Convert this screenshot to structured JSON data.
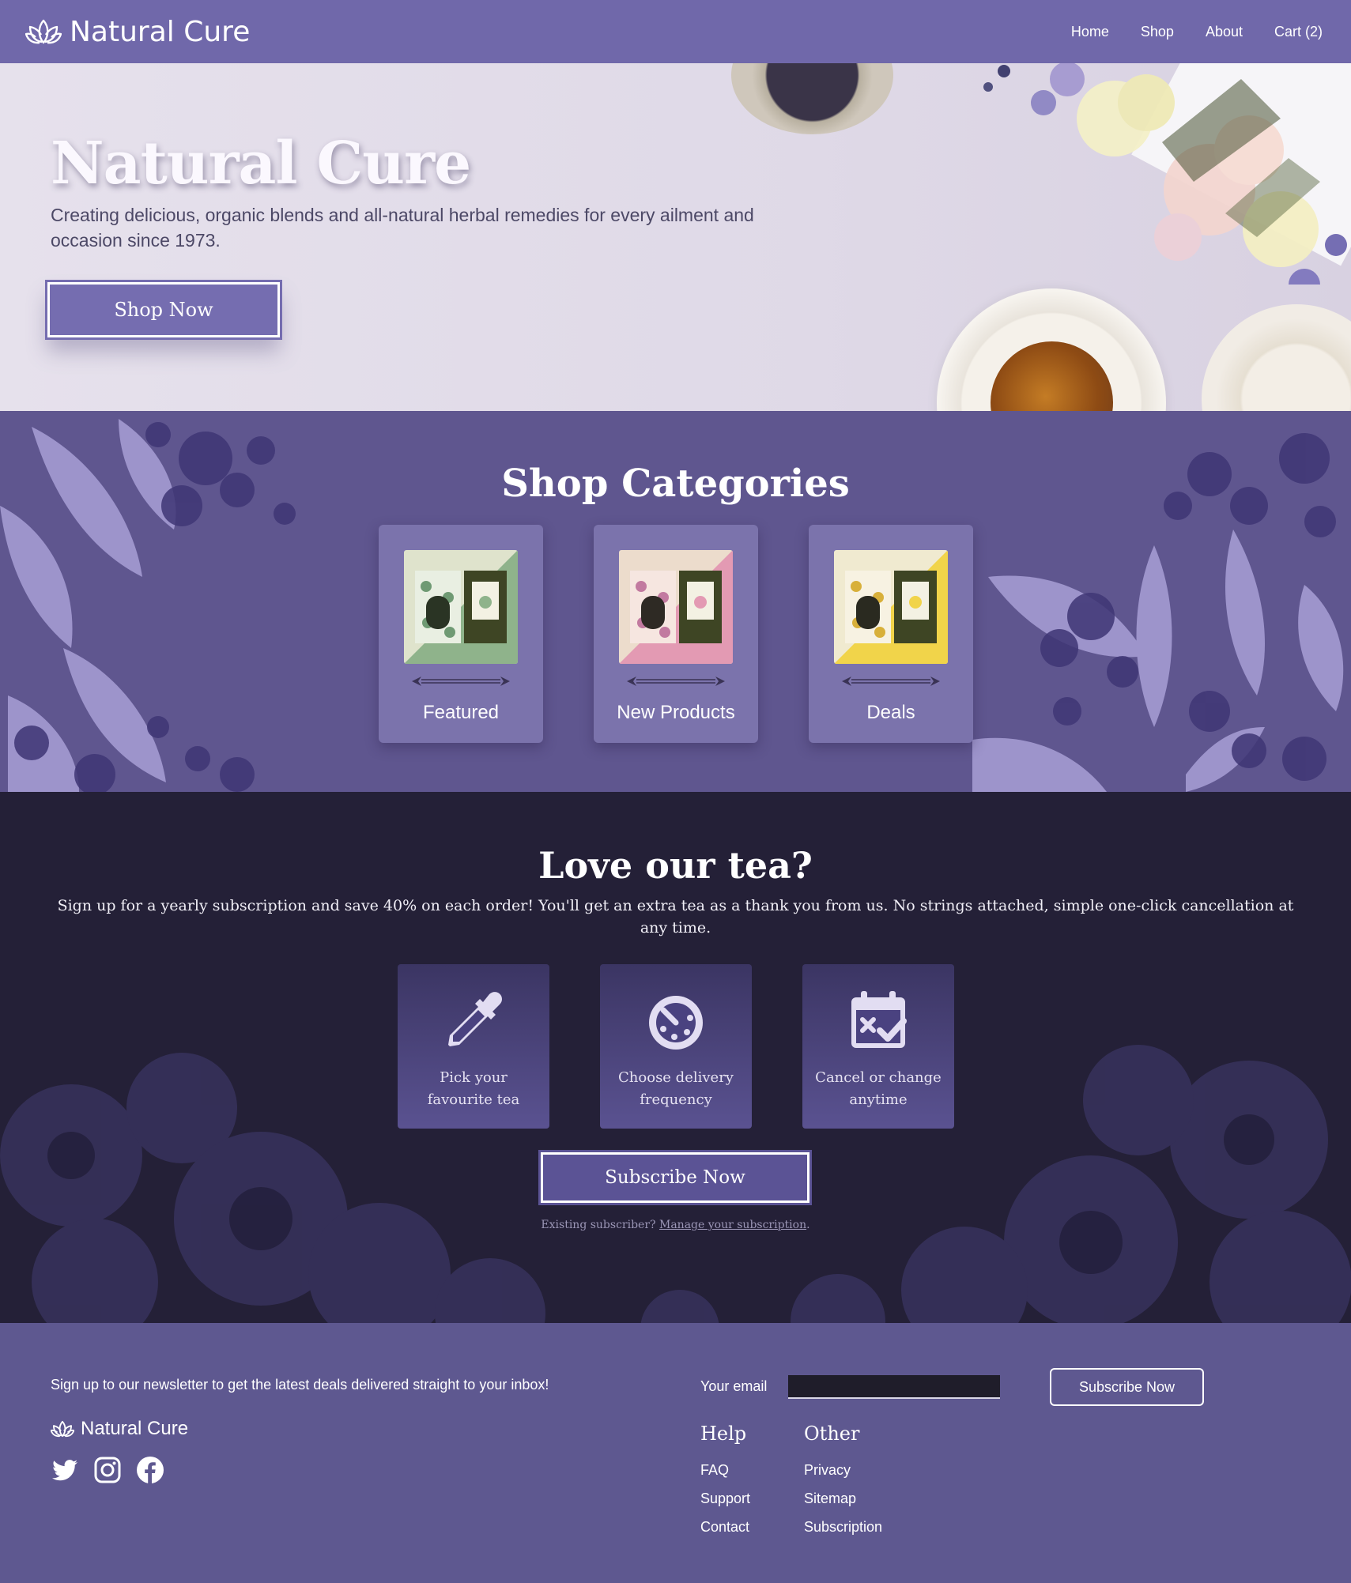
{
  "nav": {
    "brand": "Natural Cure",
    "links": [
      {
        "label": "Home"
      },
      {
        "label": "Shop"
      },
      {
        "label": "About"
      },
      {
        "label": "Cart (2)"
      }
    ]
  },
  "hero": {
    "title": "Natural Cure",
    "subtitle": "Creating delicious, organic blends and all-natural herbal remedies for every ailment and occasion since 1973.",
    "cta": "Shop Now"
  },
  "categories": {
    "title": "Shop Categories",
    "items": [
      {
        "label": "Featured",
        "accent": "#8fb38b"
      },
      {
        "label": "New Products",
        "accent": "#e39ab3"
      },
      {
        "label": "Deals",
        "accent": "#f1d44a"
      }
    ]
  },
  "subscription": {
    "title": "Love our tea?",
    "description": "Sign up for a yearly subscription and save 40% on each order! You'll get an extra tea as a thank you from us. No strings attached, simple one-click cancellation at any time.",
    "features": [
      {
        "label": "Pick your favourite tea",
        "icon": "eyedropper-icon"
      },
      {
        "label": "Choose delivery frequency",
        "icon": "stopwatch-icon"
      },
      {
        "label": "Cancel or change anytime",
        "icon": "calendar-check-icon"
      }
    ],
    "cta": "Subscribe Now",
    "existing_text": "Existing subscriber?",
    "existing_link": "Manage your subscription",
    "existing_end": "."
  },
  "footer": {
    "newsletter_text": "Sign up to our newsletter to get the latest deals delivered straight to your inbox!",
    "email_label": "Your email",
    "email_value": "",
    "subscribe_label": "Subscribe Now",
    "brand": "Natural Cure",
    "social": [
      "twitter-icon",
      "instagram-icon",
      "facebook-icon"
    ],
    "help": {
      "title": "Help",
      "links": [
        "FAQ",
        "Support",
        "Contact"
      ]
    },
    "other": {
      "title": "Other",
      "links": [
        "Privacy",
        "Sitemap",
        "Subscription"
      ]
    }
  },
  "colors": {
    "nav_bg": "#7068aa",
    "categories_bg": "#5f568f",
    "subscription_bg": "#242037",
    "footer_bg": "#5e5890"
  }
}
